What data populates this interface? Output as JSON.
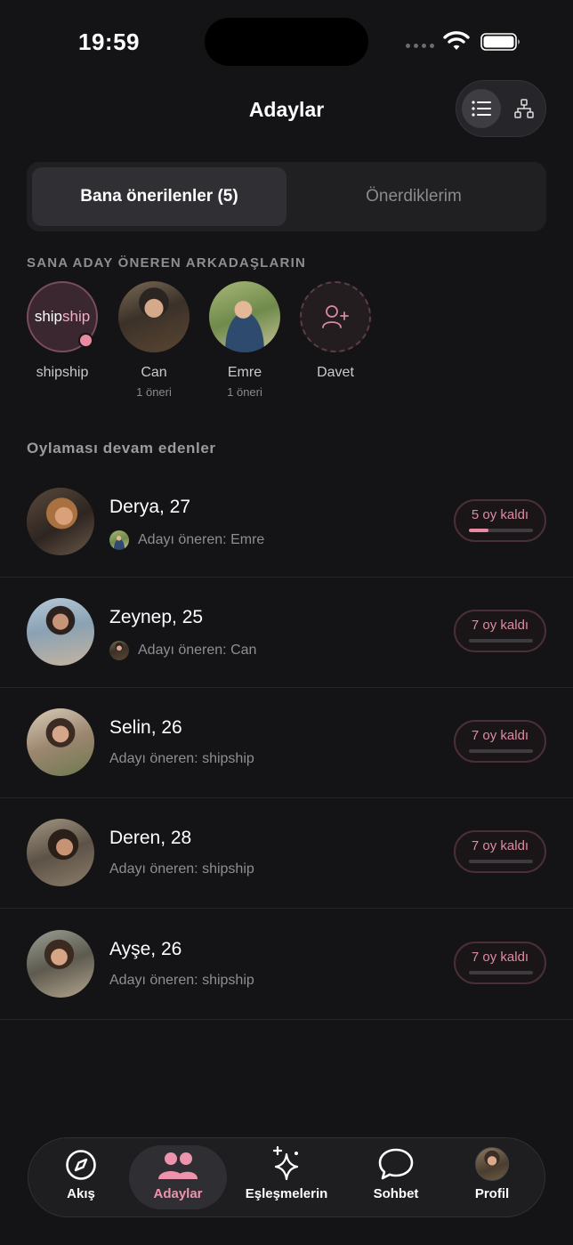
{
  "status_bar": {
    "time": "19:59"
  },
  "header": {
    "title": "Adaylar",
    "view_toggle": {
      "list_icon": "list-icon",
      "tree_icon": "hierarchy-icon",
      "active": "list"
    }
  },
  "segments": {
    "active": "Bana önerilenler (5)",
    "inactive": "Önerdiklerim"
  },
  "friends_section": {
    "title": "SANA ADAY ÖNEREN ARKADAŞLARIN",
    "friends": [
      {
        "logo_part1": "ship",
        "logo_part2": "ship",
        "name": "shipship",
        "sub": ""
      },
      {
        "name": "Can",
        "sub": "1 öneri"
      },
      {
        "name": "Emre",
        "sub": "1 öneri"
      },
      {
        "name": "Davet",
        "sub": "",
        "icon": "add-user-icon"
      }
    ]
  },
  "voting_section": {
    "title": "Oylaması devam edenler",
    "candidates": [
      {
        "name": "Derya, 27",
        "recommender": "Adayı öneren: Emre",
        "votes_left": "5 oy kaldı",
        "progress": 0.3
      },
      {
        "name": "Zeynep, 25",
        "recommender": "Adayı öneren: Can",
        "votes_left": "7 oy kaldı",
        "progress": 0
      },
      {
        "name": "Selin, 26",
        "recommender": "Adayı öneren: shipship",
        "votes_left": "7 oy kaldı",
        "progress": 0
      },
      {
        "name": "Deren, 28",
        "recommender": "Adayı öneren: shipship",
        "votes_left": "7 oy kaldı",
        "progress": 0
      },
      {
        "name": "Ayşe, 26",
        "recommender": "Adayı öneren: shipship",
        "votes_left": "7 oy kaldı",
        "progress": 0
      }
    ]
  },
  "tabbar": {
    "active": "Adaylar",
    "tabs": [
      {
        "label": "Akış",
        "icon": "compass-icon"
      },
      {
        "label": "Adaylar",
        "icon": "people-icon"
      },
      {
        "label": "Eşleşmelerin",
        "icon": "sparkles-icon"
      },
      {
        "label": "Sohbet",
        "icon": "chat-bubble-icon"
      },
      {
        "label": "Profil",
        "icon": "profile-avatar"
      }
    ]
  },
  "colors": {
    "background": "#141416",
    "accent": "#e88aa4",
    "surface": "#202023",
    "muted_text": "#8e8e93"
  }
}
